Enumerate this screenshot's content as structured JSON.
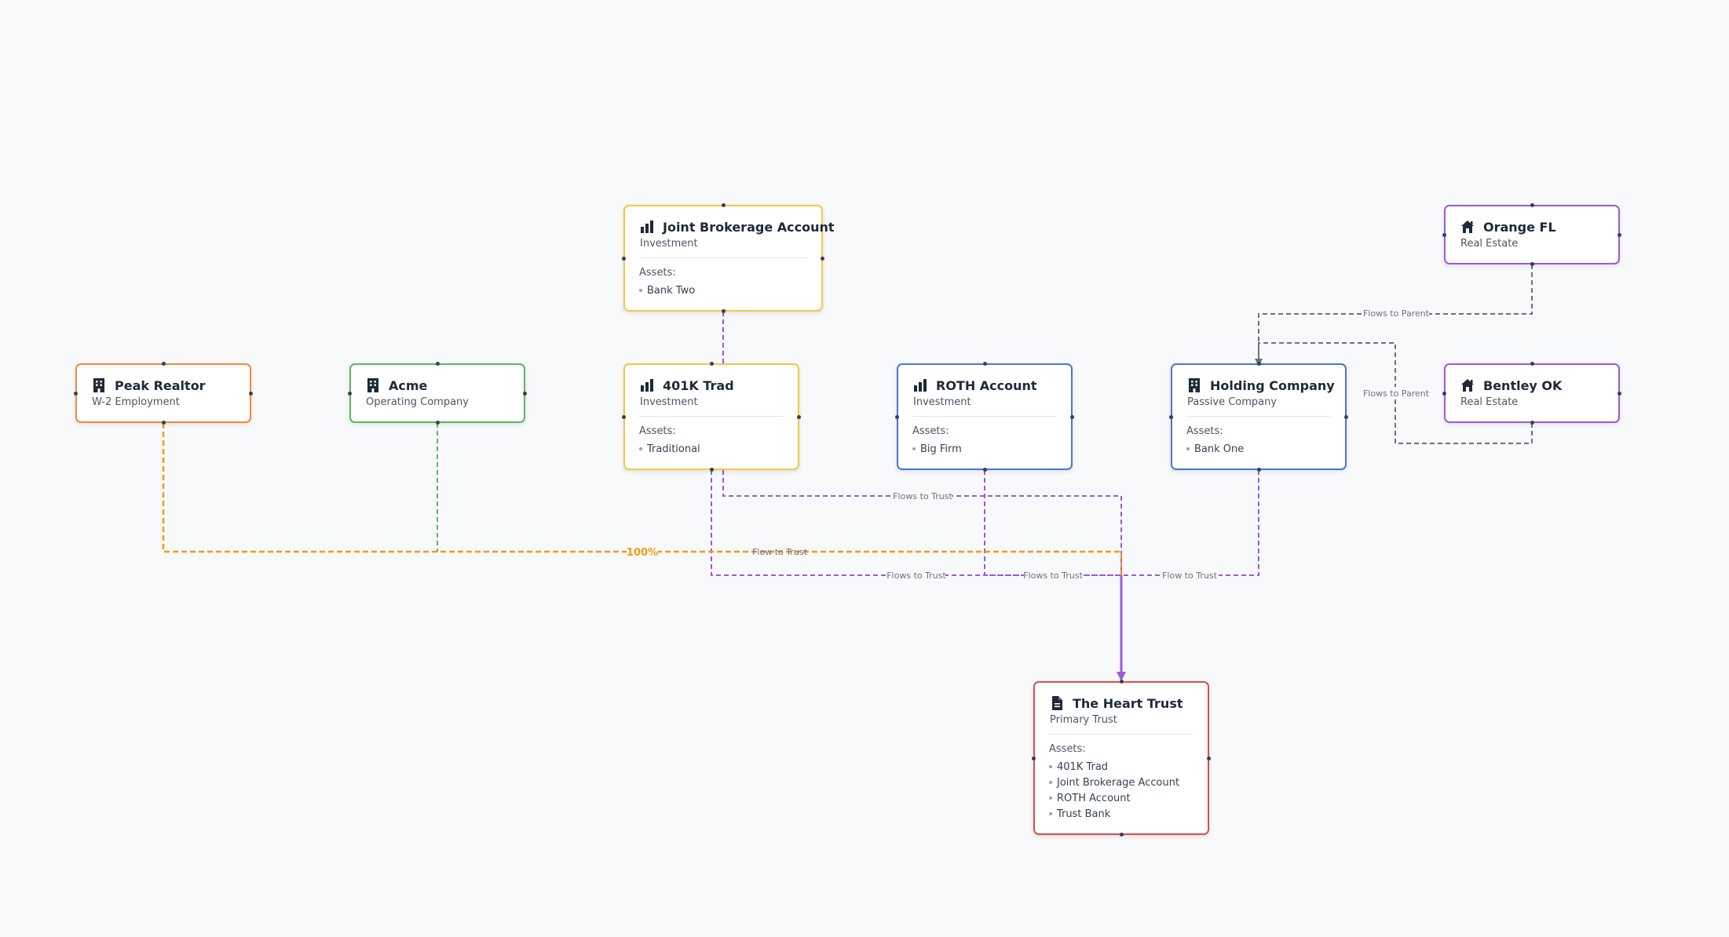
{
  "colors": {
    "orange": "#f08a3c",
    "green": "#5cb85c",
    "yellow": "#f5c842",
    "blue": "#4a75d6",
    "purple": "#9b59e0",
    "red": "#e04b4b",
    "edge_purple": "#9b59e0",
    "edge_orange": "#f39c12",
    "edge_green": "#5cb85c",
    "edge_gray": "#6b7280"
  },
  "nodes": {
    "joint_brokerage": {
      "title": "Joint Brokerage Account",
      "subtitle": "Investment",
      "assets_label": "Assets:",
      "assets": [
        "Bank Two"
      ],
      "icon": "bar-chart-icon"
    },
    "orange_fl": {
      "title": "Orange FL",
      "subtitle": "Real Estate",
      "icon": "house-icon"
    },
    "peak_realtor": {
      "title": "Peak Realtor",
      "subtitle": "W-2 Employment",
      "icon": "building-icon"
    },
    "acme": {
      "title": "Acme",
      "subtitle": "Operating Company",
      "icon": "building-icon"
    },
    "trad_401k": {
      "title": "401K Trad",
      "subtitle": "Investment",
      "assets_label": "Assets:",
      "assets": [
        "Traditional"
      ],
      "icon": "bar-chart-icon"
    },
    "roth": {
      "title": "ROTH Account",
      "subtitle": "Investment",
      "assets_label": "Assets:",
      "assets": [
        "Big Firm"
      ],
      "icon": "bar-chart-icon"
    },
    "holding": {
      "title": "Holding Company",
      "subtitle": "Passive Company",
      "assets_label": "Assets:",
      "assets": [
        "Bank One"
      ],
      "icon": "building-icon"
    },
    "bentley_ok": {
      "title": "Bentley OK",
      "subtitle": "Real Estate",
      "icon": "house-icon"
    },
    "heart_trust": {
      "title": "The Heart Trust",
      "subtitle": "Primary Trust",
      "assets_label": "Assets:",
      "assets": [
        "401K Trad",
        "Joint Brokerage Account",
        "ROTH Account",
        "Trust Bank"
      ],
      "icon": "document-icon"
    }
  },
  "edge_labels": {
    "orange_to_holding": "Flows to Parent",
    "bentley_to_holding": "Flows to Parent",
    "trad_to_trust": "Flows to Trust",
    "percent": "100%",
    "peak_to_trust": "Flow to Trust",
    "brokerage_to_trust": "Flows to Trust",
    "roth_to_trust": "Flows to Trust",
    "holding_to_trust": "Flow to Trust"
  }
}
